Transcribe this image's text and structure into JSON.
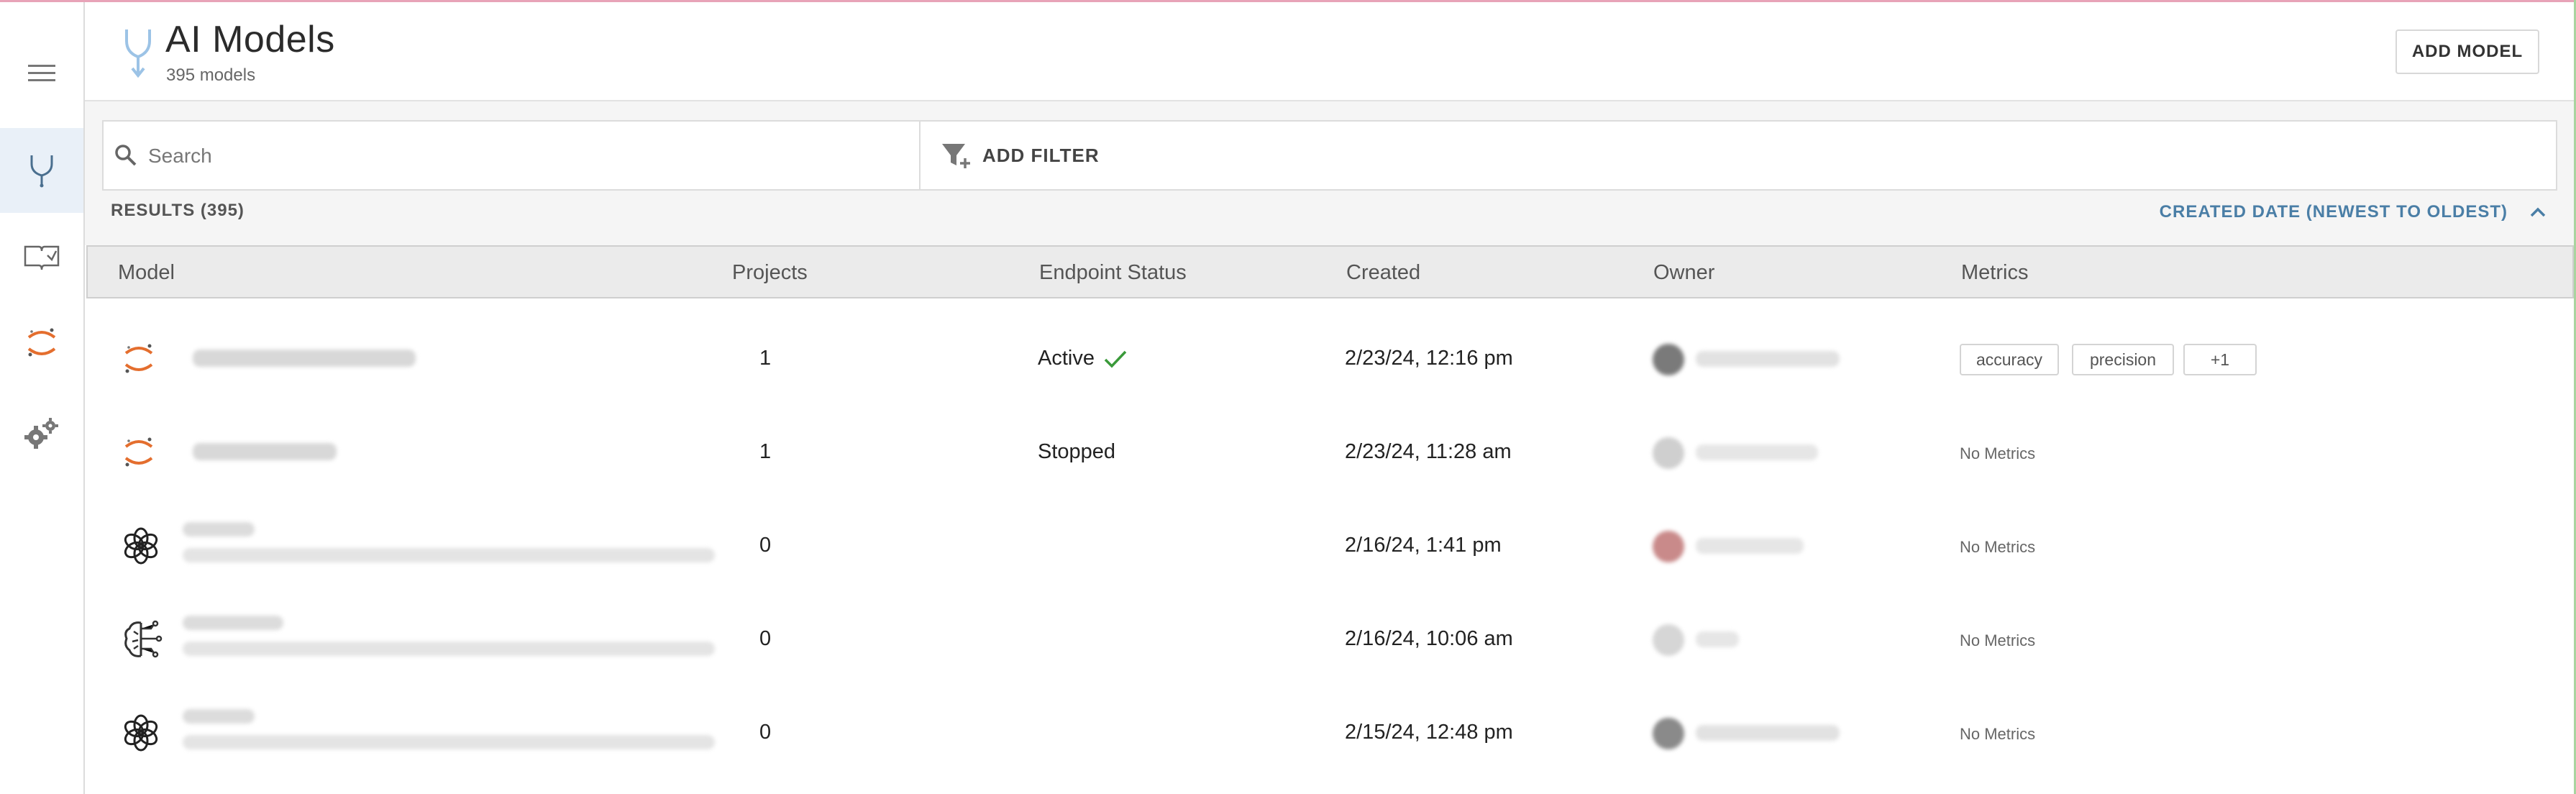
{
  "header": {
    "title": "AI Models",
    "subtitle": "395 models",
    "add_button": "ADD MODEL"
  },
  "filters": {
    "search_placeholder": "Search",
    "add_filter_label": "ADD FILTER",
    "results_label": "RESULTS (395)",
    "sort_label": "CREATED DATE (NEWEST TO OLDEST)"
  },
  "table": {
    "columns": [
      "Model",
      "Projects",
      "Endpoint Status",
      "Created",
      "Owner",
      "Metrics"
    ],
    "rows": [
      {
        "model_icon": "jupyter-icon",
        "projects": "1",
        "status": "Active",
        "status_icon": "check-icon",
        "created": "2/23/24, 12:16 pm",
        "metrics": [
          "accuracy",
          "precision",
          "+1"
        ],
        "no_metrics": ""
      },
      {
        "model_icon": "jupyter-icon",
        "projects": "1",
        "status": "Stopped",
        "status_icon": "",
        "created": "2/23/24, 11:28 am",
        "metrics": [],
        "no_metrics": "No Metrics"
      },
      {
        "model_icon": "openai-icon",
        "projects": "0",
        "status": "",
        "status_icon": "",
        "created": "2/16/24, 1:41 pm",
        "metrics": [],
        "no_metrics": "No Metrics"
      },
      {
        "model_icon": "ai-brain-icon",
        "projects": "0",
        "status": "",
        "status_icon": "",
        "created": "2/16/24, 10:06 am",
        "metrics": [],
        "no_metrics": "No Metrics"
      },
      {
        "model_icon": "openai-icon",
        "projects": "0",
        "status": "",
        "status_icon": "",
        "created": "2/15/24, 12:48 pm",
        "metrics": [],
        "no_metrics": "No Metrics"
      }
    ]
  },
  "sidebar": {
    "items": [
      "menu-icon",
      "models-icon",
      "catalog-icon",
      "jupyter-icon",
      "settings-icon"
    ]
  },
  "colors": {
    "accent": "#4a7ea6",
    "active_sidebar": "#e9f0f8",
    "status_ok": "#3a9a3a",
    "jupyter": "#e46e2e"
  }
}
